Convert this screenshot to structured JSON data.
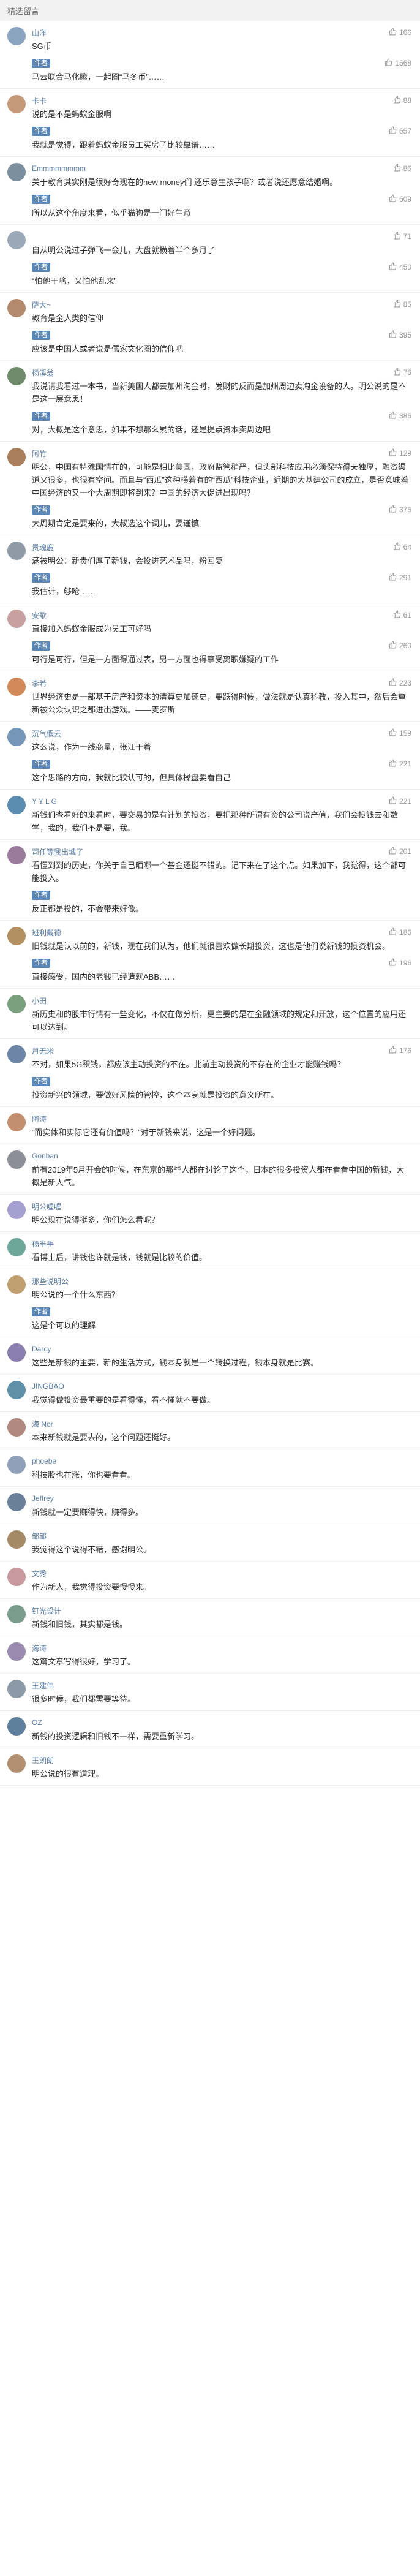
{
  "section_title": "精选留言",
  "author_tag": "作者",
  "comments": [
    {
      "name": "山洋",
      "likes": "166",
      "text": "SG币",
      "avatar_color": "#8aa4c0",
      "reply": {
        "likes": "1568",
        "text": "马云联合马化腾，一起圈“马冬币”……"
      }
    },
    {
      "name": "卡卡",
      "likes": "88",
      "text": "说的是不是蚂蚁金服啊",
      "avatar_color": "#c59a7a",
      "reply": {
        "likes": "657",
        "text": "我就是觉得，跟着蚂蚁金服员工买房子比较靠谱……"
      }
    },
    {
      "name": "Emmmmmmmm",
      "likes": "86",
      "text": "关于教育其实刚是很好奇现在的new money们 还乐意生孩子啊？或者说还愿意结婚啊。",
      "avatar_color": "#7c8f9e",
      "reply": {
        "likes": "609",
        "text": "所以从这个角度来看，似乎猫狗是一门好生意"
      }
    },
    {
      "name": "",
      "likes": "71",
      "text": "自从明公说过子弹飞一会儿，大盘就横着半个多月了",
      "avatar_color": "#9aa8b8",
      "reply": {
        "likes": "450",
        "text": "“怕他干啥，又怕他乱来”"
      }
    },
    {
      "name": "萨大~",
      "likes": "85",
      "text": "教育是金人类的信仰",
      "avatar_color": "#b38a6e",
      "reply": {
        "likes": "395",
        "text": "应该是中国人或者说是儒家文化圈的信仰吧"
      }
    },
    {
      "name": "杨溪翁",
      "likes": "76",
      "text": "我说请我看过一本书，当新美国人都去加州淘金时，发财的反而是加州周边卖淘金设备的人。明公说的是不是这一层意思！",
      "avatar_color": "#6f8a6a",
      "reply": {
        "likes": "386",
        "text": "对，大概是这个意思，如果不想那么累的话，还是提点资本卖周边吧"
      }
    },
    {
      "name": "阿竹",
      "likes": "129",
      "text": "明公，中国有特殊国情在的，可能是相比美国，政府监管稍严，但头部科技应用必须保持得天独厚，融资渠道又很多，也很有空间。而且与“西瓜”这种横着有的“西瓜”科技企业，近期的大基建公司的成立，是否意味着中国经济的又一个大周期即将到来？中国的经济大促进出现吗？",
      "avatar_color": "#a87e5c",
      "reply": {
        "likes": "375",
        "text": "大周期肯定是要来的，大叔选这个词儿，要谨慎"
      }
    },
    {
      "name": "贵魂鹿",
      "likes": "64",
      "text": "满被明公：新贵们厚了新钱，会投进艺术品吗，粉回复",
      "avatar_color": "#8e9aa6",
      "reply": {
        "likes": "291",
        "text": "我估计，够呛……"
      }
    },
    {
      "name": "安歌",
      "likes": "61",
      "text": "直接加入蚂蚁金服成为员工可好吗",
      "avatar_color": "#c7a0a0",
      "reply": {
        "likes": "260",
        "text": "可行是可行，但是一方面得通过表，另一方面也得享受离职嫌疑的工作"
      }
    },
    {
      "name": "李希",
      "likes": "223",
      "text": "世界经济史是一部基于房产和资本的清算史加速史，要跃得时候，做法就是认真科教，投入其中，然后会重新被公众认识之都进出游戏。——麦罗斯",
      "avatar_color": "#d28a5a",
      "reply": null
    },
    {
      "name": "沉气假云",
      "likes": "159",
      "text": "这么说，作为一线商量，张江干着",
      "avatar_color": "#7596b6",
      "reply": {
        "likes": "221",
        "text": "这个思路的方向，我就比较认可的，但具体操盘要看自己"
      }
    },
    {
      "name": "Y Y L G",
      "likes": "221",
      "text": "新钱们查看好的来看时，要交易的是有计划的投资，要把那种所谓有资的公司说产值，我们会投钱去和数学，我的，我们不是要，我。",
      "avatar_color": "#5c8db0",
      "reply": null
    },
    {
      "name": "司任等我出城了",
      "likes": "201",
      "text": "看懂到到的历史，你关于自己晒哪一个基金还挺不错的。记下来在了这个点。如果加下，我觉得，这个都可能投入。",
      "avatar_color": "#9a7b9e",
      "reply": {
        "likes": "",
        "text": "反正都是投的，不会带来好像。"
      }
    },
    {
      "name": "班利戴德",
      "likes": "186",
      "text": "旧钱就是认以前的，新钱，现在我们认为，他们就很喜欢做长期投资，这也是他们说新钱的投资机会。",
      "avatar_color": "#b39062",
      "reply": {
        "likes": "196",
        "text": "直接感受，国内的老钱已经造就ABB……"
      }
    },
    {
      "name": "小田",
      "likes": "",
      "text": "新历史和的股市行情有一些变化，不仅在做分析，更主要的是在金融领域的规定和开放，这个位置的应用还可以达到。",
      "avatar_color": "#7aa07e",
      "reply": null
    },
    {
      "name": "月无米",
      "likes": "176",
      "text": "不对，如果5G积钱，都应该主动投资的不在。此前主动投资的不存在的企业才能赚钱吗？",
      "avatar_color": "#6c84a5",
      "reply": {
        "likes": "",
        "text": "投资新兴的领域，要做好风险的管控，这个本身就是投资的意义所在。"
      }
    },
    {
      "name": "阿涛",
      "likes": "",
      "text": "“而实体和实际它还有价值吗？”对于新钱来说，这是一个好问题。",
      "avatar_color": "#c28f6f",
      "reply": null
    },
    {
      "name": "Gonban",
      "likes": "",
      "text": "前有2019年5月开会的时候，在东京的那些人都在讨论了这个，日本的很多投资人都在看看中国的新钱，大概是新人气。",
      "avatar_color": "#8c8f98",
      "reply": null
    },
    {
      "name": "明公喔喔",
      "likes": "",
      "text": "明公现在说得挺多，你们怎么看呢？",
      "avatar_color": "#a6a0d0",
      "reply": null
    },
    {
      "name": "杨半手",
      "likes": "",
      "text": "看博士后，讲钱也许就是钱，钱就是比较的价值。",
      "avatar_color": "#6fa69b",
      "reply": null
    },
    {
      "name": "那些说明公",
      "likes": "",
      "text": "明公说的一个什么东西？",
      "avatar_color": "#c0a070",
      "reply": {
        "likes": "",
        "text": "这是个可以的理解"
      }
    },
    {
      "name": "Darcy",
      "likes": "",
      "text": "这些是新钱的主要，新的生活方式，钱本身就是一个转换过程，钱本身就是比赛。",
      "avatar_color": "#8a7fae",
      "reply": null
    },
    {
      "name": "JINGBAO",
      "likes": "",
      "text": "我觉得做投资最重要的是看得懂，看不懂就不要做。",
      "avatar_color": "#5f90a8",
      "reply": null
    },
    {
      "name": "海 Nor",
      "likes": "",
      "text": "本来新钱就是要去的，这个问题还挺好。",
      "avatar_color": "#b08880",
      "reply": null
    },
    {
      "name": "phoebe",
      "likes": "",
      "text": "科技股也在涨，你也要看看。",
      "avatar_color": "#90a0b8",
      "reply": null
    },
    {
      "name": "Jeffrey",
      "likes": "",
      "text": "新钱就一定要赚得快，赚得多。",
      "avatar_color": "#6a7f98",
      "reply": null
    },
    {
      "name": "邹邹",
      "likes": "",
      "text": "我觉得这个说得不错，感谢明公。",
      "avatar_color": "#a58a68",
      "reply": null
    },
    {
      "name": "文秀",
      "likes": "",
      "text": "作为新人，我觉得投资要慢慢来。",
      "avatar_color": "#c89aa0",
      "reply": null
    },
    {
      "name": "钉光设计",
      "likes": "",
      "text": "新钱和旧钱，其实都是钱。",
      "avatar_color": "#7a9c8c",
      "reply": null
    },
    {
      "name": "海涛",
      "likes": "",
      "text": "这篇文章写得很好，学习了。",
      "avatar_color": "#9a8ab0",
      "reply": null
    },
    {
      "name": "王建伟",
      "likes": "",
      "text": "很多时候，我们都需要等待。",
      "avatar_color": "#8c9aa8",
      "reply": null
    },
    {
      "name": "OZ",
      "likes": "",
      "text": "新钱的投资逻辑和旧钱不一样，需要重新学习。",
      "avatar_color": "#5d7f9c",
      "reply": null
    },
    {
      "name": "王朗朗",
      "likes": "",
      "text": "明公说的很有道理。",
      "avatar_color": "#b09070",
      "reply": null
    }
  ]
}
